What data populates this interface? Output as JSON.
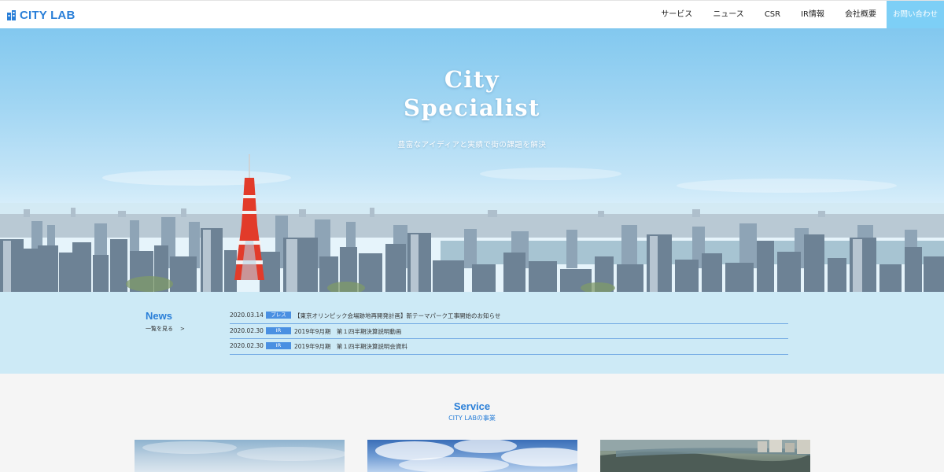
{
  "header": {
    "logo_text": "CITY LAB",
    "logo_icon": "building-icon",
    "nav": [
      "サービス",
      "ニュース",
      "CSR",
      "IR情報",
      "会社概要"
    ],
    "contact_label": "お問い合わせ",
    "colors": {
      "brand": "#2a7fd8",
      "contact_bg": "#7dcff6"
    }
  },
  "hero": {
    "title_line1": "City",
    "title_line2": "Specialist",
    "subtitle": "豊富なアイディアと実績で街の課題を解決"
  },
  "news": {
    "title": "News",
    "more_label": "一覧を見る",
    "more_arrow": ">",
    "items": [
      {
        "date": "2020.03.14",
        "tag": "プレス",
        "text": "【東京オリンピック会場跡地再開発計画】新テーマパーク工事開始のお知らせ"
      },
      {
        "date": "2020.02.30",
        "tag": "IR",
        "text": "2019年9月期　第１四半期決算説明動画"
      },
      {
        "date": "2020.02.30",
        "tag": "IR",
        "text": "2019年9月期　第１四半期決算説明会資料"
      }
    ],
    "colors": {
      "background": "#cdeaf6",
      "badge": "#4a90e2"
    }
  },
  "service": {
    "title": "Service",
    "subtitle": "CITY LABの事業"
  }
}
